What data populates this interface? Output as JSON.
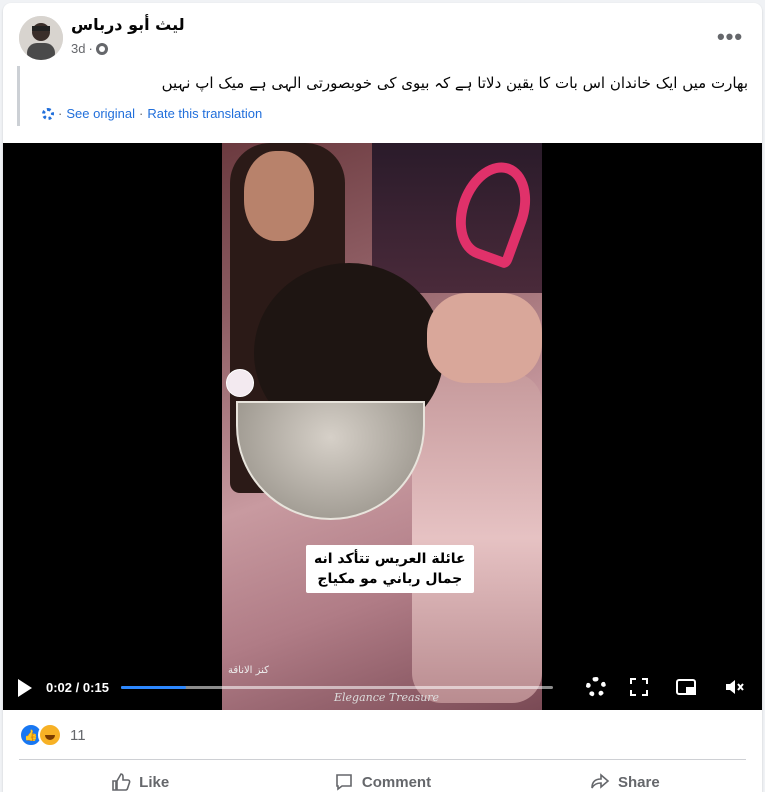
{
  "post": {
    "author": "ليث أبو درباس",
    "time": "3d",
    "time_sep": "·",
    "more_label": "•••",
    "translation": "بھارت میں ایک خاندان اس بات کا یقین دلاتا ہے کہ بیوی کی خوبصورتی الہی ہے میک اپ نہیں",
    "see_original": "See original",
    "rate_translation": "Rate this translation",
    "link_sep": "·"
  },
  "video": {
    "caption_line1": "عائلة العريس تتأكد انه",
    "caption_line2": "جمال رباني مو مكياج",
    "watermark_arabic": "كنز الاناقة",
    "watermark_english": "Elegance Treasure",
    "current_time": "0:02",
    "duration": "0:15",
    "time_sep": "/",
    "progress_fraction": 0.15
  },
  "reactions": {
    "count": "11",
    "types": [
      "like-icon",
      "haha-icon"
    ]
  },
  "actions": [
    {
      "label": "Like",
      "icon": "like-thumb-icon"
    },
    {
      "label": "Comment",
      "icon": "comment-bubble-icon"
    },
    {
      "label": "Share",
      "icon": "share-arrow-icon"
    }
  ],
  "colors": {
    "link": "#216fdb",
    "progress": "#2d88ff",
    "like": "#1877f2",
    "haha": "#f7b125"
  }
}
